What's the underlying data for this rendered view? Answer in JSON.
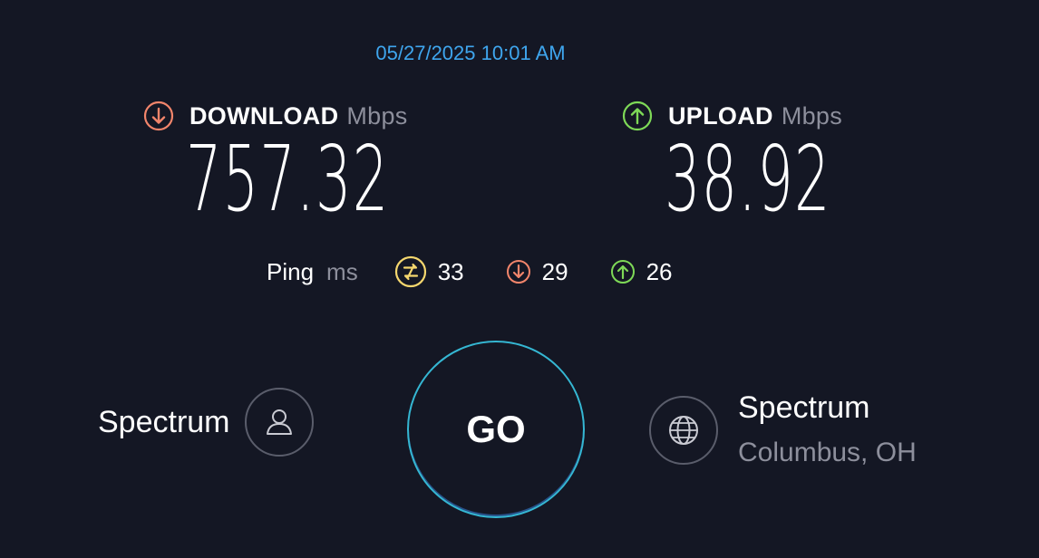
{
  "timestamp": "05/27/2025 10:01 AM",
  "download": {
    "label": "DOWNLOAD",
    "unit": "Mbps",
    "value": "757.32",
    "icon": "download-arrow-icon",
    "color": "#f2856b"
  },
  "upload": {
    "label": "UPLOAD",
    "unit": "Mbps",
    "value": "38.92",
    "icon": "upload-arrow-icon",
    "color": "#7ed957"
  },
  "ping": {
    "label": "Ping",
    "unit": "ms",
    "idle": {
      "value": "33",
      "icon": "ping-idle-icon",
      "color": "#f5d76e"
    },
    "download": {
      "value": "29",
      "icon": "download-arrow-icon",
      "color": "#f2856b"
    },
    "upload": {
      "value": "26",
      "icon": "upload-arrow-icon",
      "color": "#7ed957"
    }
  },
  "go_button": {
    "label": "GO",
    "ring_color": "#35b7d3"
  },
  "provider": {
    "name": "Spectrum",
    "icon": "user-icon"
  },
  "server": {
    "name": "Spectrum",
    "location": "Columbus, OH",
    "icon": "globe-icon"
  },
  "colors": {
    "background": "#141724",
    "accent_blue": "#3fa6ee",
    "muted_text": "#8d8f9c"
  }
}
